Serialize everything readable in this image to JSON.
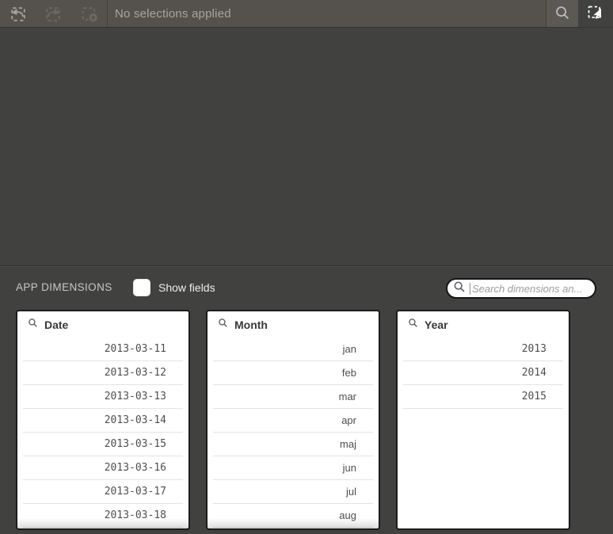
{
  "toolbar": {
    "status_text": "No selections applied",
    "icons": {
      "step_back": "step-back-icon",
      "step_forward": "step-forward-icon",
      "clear_selections": "clear-all-selections-icon",
      "search": "search-icon",
      "selections_tool": "selections-tool-icon"
    }
  },
  "colors": {
    "toolbar_bg": "#55524d",
    "page_bg": "#414140",
    "card_bg": "#ffffff",
    "card_border": "#1c1c1c",
    "status_text": "#a7a5a1",
    "active_icon": "#ffffff"
  },
  "dimensions_section": {
    "title": "APP DIMENSIONS",
    "show_fields": {
      "label": "Show fields",
      "checked": false
    },
    "search": {
      "placeholder": "Search dimensions an...",
      "icon": "search-icon"
    },
    "panels": [
      {
        "title": "Date",
        "value_style": "mono",
        "has_more": true,
        "values": [
          "2013-03-11",
          "2013-03-12",
          "2013-03-13",
          "2013-03-14",
          "2013-03-15",
          "2013-03-16",
          "2013-03-17",
          "2013-03-18"
        ]
      },
      {
        "title": "Month",
        "value_style": "text",
        "has_more": true,
        "values": [
          "jan",
          "feb",
          "mar",
          "apr",
          "maj",
          "jun",
          "jul",
          "aug"
        ]
      },
      {
        "title": "Year",
        "value_style": "mono",
        "has_more": false,
        "values": [
          "2013",
          "2014",
          "2015"
        ]
      }
    ]
  }
}
